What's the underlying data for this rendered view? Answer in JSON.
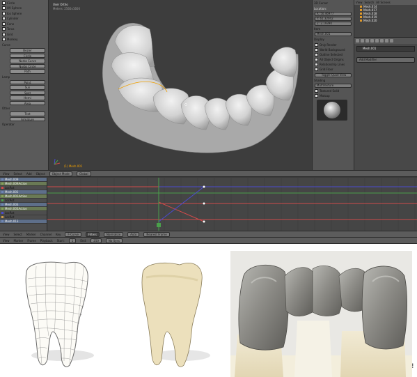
{
  "viewport": {
    "title": "User Ortho",
    "subtitle": "Meters: 2560x1600",
    "object_label": "(1) Mesh.001"
  },
  "tool_shelf": {
    "items": [
      "Circle",
      "UV Sphere",
      "Ico Sphere",
      "Cylinder",
      "Cone",
      "Torus",
      "Grid",
      "Monkey"
    ],
    "curve_header": "Curve",
    "curve_items": [
      "Bezier",
      "Circle",
      "Nurbs Curve",
      "Nurbs Circle",
      "Path"
    ],
    "lamp_header": "Lamp",
    "lamp_items": [
      "Point",
      "Sun",
      "Spot",
      "Hemi",
      "Area"
    ],
    "other_header": "Other",
    "other_items": [
      "Text",
      "Armature"
    ],
    "operator_label": "Operator"
  },
  "n_panel": {
    "cursor_header": "3D Cursor",
    "location_label": "Location:",
    "x": "X:  50.46977",
    "y": "Y:  61.32042",
    "z": "Z:  2.19390",
    "item_header": "Item",
    "item_name": "Mesh.001",
    "display_header": "Display",
    "display_options": [
      "Only Render",
      "World Background",
      "Outline Selected",
      "All Object Origins",
      "Relationship Lines"
    ],
    "grid_label": "Grid Floor",
    "toggle_quad": "Toggle Quad View",
    "shading_header": "Shading",
    "shading_mode": "Multitexture",
    "shading_options": [
      "Textured Solid",
      "Matcap"
    ]
  },
  "outliner": {
    "menu": [
      "View",
      "Search",
      "All Scenes"
    ],
    "rows": [
      "Mesh.014",
      "Mesh.017",
      "Mesh.018",
      "Mesh.019",
      "Mesh.020"
    ]
  },
  "properties": {
    "object_name": "Mesh.001",
    "add_modifier": "Add Modifier"
  },
  "view3d_header": {
    "menus": [
      "View",
      "Select",
      "Add",
      "Object"
    ],
    "mode": "Object Mode",
    "orientation": "Global"
  },
  "graph_channels": [
    {
      "label": "Mesh.009",
      "kind": "obj",
      "color": "#6f86b5"
    },
    {
      "label": "Mesh.009Action",
      "kind": "act",
      "color": "#86a35a"
    },
    {
      "label": "LocRot",
      "kind": "ch",
      "color": "#d04a4a"
    },
    {
      "label": "Mesh.001",
      "kind": "obj",
      "color": "#6f86b5"
    },
    {
      "label": "Mesh.001Action",
      "kind": "act",
      "color": "#86a35a"
    },
    {
      "label": "LocRot",
      "kind": "ch",
      "color": "#4aa04a"
    },
    {
      "label": "Mesh.003",
      "kind": "obj",
      "color": "#6f86b5"
    },
    {
      "label": "Mesh.003Action",
      "kind": "act",
      "color": "#86a35a"
    },
    {
      "label": "LocRot",
      "kind": "ch",
      "color": "#4a4ad0"
    },
    {
      "label": "LocRot",
      "kind": "ch",
      "color": "#d0a04a"
    },
    {
      "label": "Mesh.013",
      "kind": "obj",
      "color": "#6f86b5"
    }
  ],
  "graph_header": {
    "menus": [
      "View",
      "Select",
      "Marker",
      "Channel",
      "Key"
    ],
    "mode": "F-Curve",
    "filters": "Filters",
    "normalize": "Normalize",
    "auto": "Auto",
    "nearest": "Nearest Frame"
  },
  "timeline_header": {
    "menus": [
      "View",
      "Marker",
      "Frame",
      "Playback"
    ],
    "start": "Start:",
    "start_val": "1",
    "end": "End:",
    "end_val": "250",
    "sync": "No Sync"
  },
  "trailing_mark": "!"
}
